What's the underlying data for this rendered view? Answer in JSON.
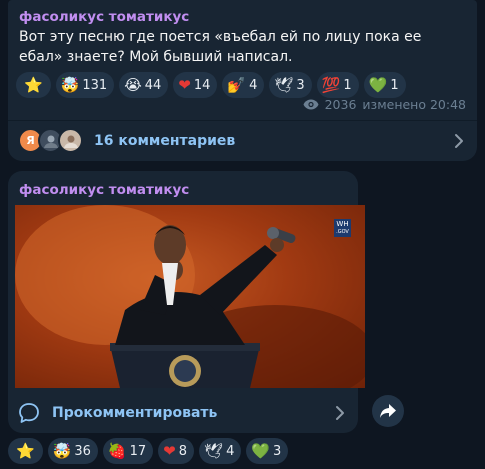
{
  "post1": {
    "sender": "фасоликус томатикус",
    "text": "Вот эту песню где поется «въебал ей по лицу пока ее ебал» знаете? Мой бывший написал.",
    "reactions": [
      {
        "emoji": "⭐",
        "icon": "star-icon",
        "count": ""
      },
      {
        "emoji": "🤯",
        "icon": "mind-blown-icon",
        "count": "131"
      },
      {
        "emoji": "😭",
        "icon": "crying-face-icon",
        "count": "44"
      },
      {
        "emoji": "❤",
        "icon": "heart-icon",
        "count": "14"
      },
      {
        "emoji": "💅",
        "icon": "nail-polish-icon",
        "count": "4"
      },
      {
        "emoji": "🕊",
        "icon": "dove-icon",
        "count": "3"
      },
      {
        "emoji": "💯",
        "icon": "hundred-icon",
        "count": "1"
      },
      {
        "emoji": "💚",
        "icon": "green-heart-icon",
        "count": "1"
      }
    ],
    "views": "2036",
    "edited": "изменено 20:48",
    "comments_avatar_letter": "Я",
    "comments_label": "16 комментариев"
  },
  "post2": {
    "sender": "фасоликус томатикус",
    "media_badge": "WH",
    "media_badge_sub": ".GOV",
    "comment_button_label": "Прокомментировать",
    "reactions": [
      {
        "emoji": "⭐",
        "icon": "star-icon",
        "count": ""
      },
      {
        "emoji": "🤯",
        "icon": "mind-blown-icon",
        "count": "36"
      },
      {
        "emoji": "🍓",
        "icon": "strawberry-icon",
        "count": "17"
      },
      {
        "emoji": "❤",
        "icon": "heart-icon",
        "count": "8"
      },
      {
        "emoji": "🕊",
        "icon": "dove-icon",
        "count": "4"
      },
      {
        "emoji": "💚",
        "icon": "green-heart-icon",
        "count": "3"
      }
    ]
  },
  "colors": {
    "background": "#0e1621",
    "bubble": "#182533",
    "sender": "#c18ef0",
    "link": "#8ec4f4",
    "reaction_bg": "#223447",
    "meta": "#6b7f92"
  }
}
